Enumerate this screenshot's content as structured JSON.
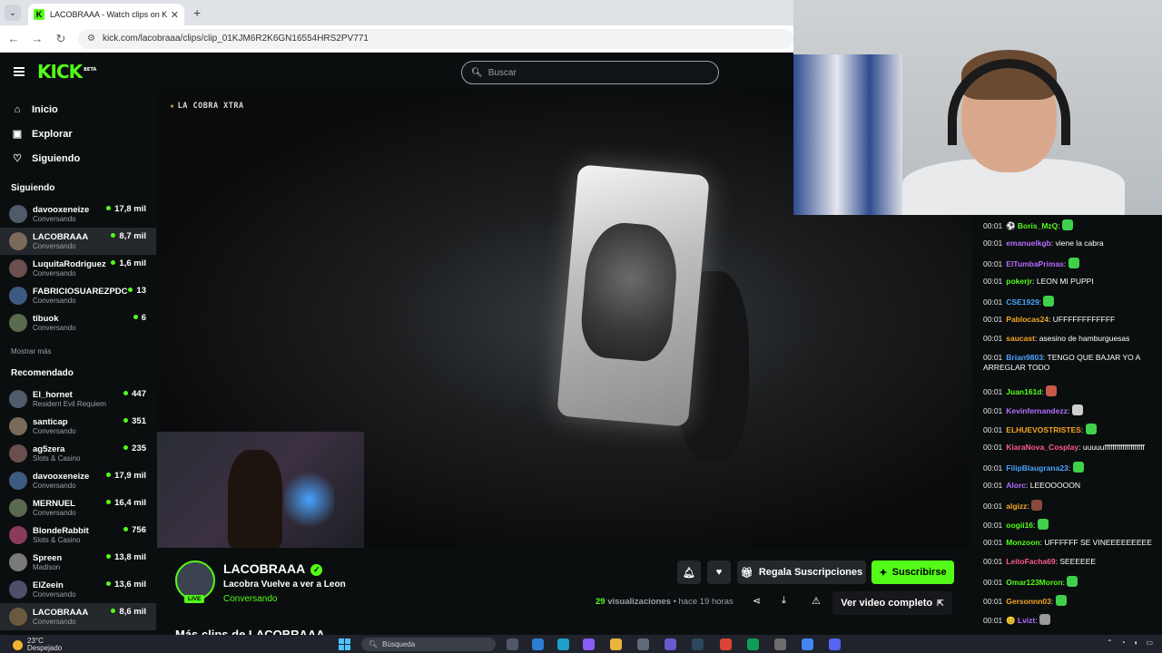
{
  "browser": {
    "tab_title": "LACOBRAAA - Watch clips on K",
    "tab_close": "✕",
    "new_tab": "+",
    "url": "kick.com/lacobraaa/clips/clip_01KJM6R2K6GN16554HRS2PV771"
  },
  "header": {
    "logo": "KICK",
    "logo_badge": "BETA",
    "search_placeholder": "Buscar"
  },
  "sidebar": {
    "nav": [
      {
        "label": "Inicio",
        "icon": "home-icon"
      },
      {
        "label": "Explorar",
        "icon": "compass-icon"
      },
      {
        "label": "Siguiendo",
        "icon": "heart-icon"
      }
    ],
    "following_title": "Siguiendo",
    "following": [
      {
        "name": "davooxeneize",
        "cat": "Conversando",
        "viewers": "17,8 mil"
      },
      {
        "name": "LACOBRAAA",
        "cat": "Conversando",
        "viewers": "8,7 mil"
      },
      {
        "name": "LuquitaRodriguez",
        "cat": "Conversando",
        "viewers": "1,6 mil"
      },
      {
        "name": "FABRICIOSUAREZPDC",
        "cat": "Conversando",
        "viewers": "13"
      },
      {
        "name": "tibuok",
        "cat": "Conversando",
        "viewers": "6"
      }
    ],
    "show_more": "Mostrar más",
    "recommended_title": "Recomendado",
    "recommended": [
      {
        "name": "El_hornet",
        "cat": "Resident Evil Requiem",
        "viewers": "447"
      },
      {
        "name": "santicap",
        "cat": "Conversando",
        "viewers": "351"
      },
      {
        "name": "ag5zera",
        "cat": "Slots & Casino",
        "viewers": "235"
      },
      {
        "name": "davooxeneize",
        "cat": "Conversando",
        "viewers": "17,9 mil"
      },
      {
        "name": "MERNUEL",
        "cat": "Conversando",
        "viewers": "16,4 mil"
      },
      {
        "name": "BlondeRabbit",
        "cat": "Slots & Casino",
        "viewers": "756"
      },
      {
        "name": "Spreen",
        "cat": "Madison",
        "viewers": "13,8 mil"
      },
      {
        "name": "ElZeein",
        "cat": "Conversando",
        "viewers": "13,6 mil"
      },
      {
        "name": "LACOBRAAA",
        "cat": "Conversando",
        "viewers": "8,6 mil"
      }
    ]
  },
  "video": {
    "watermark": "LA COBRA XTRA"
  },
  "clip": {
    "channel": "LACOBRAAA",
    "live_badge": "LIVE",
    "title": "Lacobra Vuelve a ver a Leon",
    "category": "Conversando",
    "views_count": "29",
    "views_label": "visualizaciones",
    "time": "• hace 19 horas",
    "gift_button": "Regala Suscripciones",
    "subscribe_button": "Suscribirse",
    "full_video_button": "Ver video completo",
    "more_clips": "Más clips de LACOBRAAA"
  },
  "chat": [
    {
      "time": "00:01",
      "user": "Boris_MzQ",
      "color": "#53fc18",
      "text": "",
      "emote": "#3fd14a",
      "badge": "⚽"
    },
    {
      "time": "00:01",
      "user": "emanuelkgb",
      "color": "#b56cff",
      "text": "viene la cabra"
    },
    {
      "time": "00:01",
      "user": "ElTumbaPrimas",
      "color": "#b56cff",
      "text": "",
      "emote": "#3fd14a"
    },
    {
      "time": "00:01",
      "user": "pokerjr",
      "color": "#53fc18",
      "text": "LEON MI PUPPI"
    },
    {
      "time": "00:01",
      "user": "CSE1929",
      "color": "#4aa3ff",
      "text": "",
      "emote": "#3fd14a"
    },
    {
      "time": "00:01",
      "user": "Pablocas24",
      "color": "#f5a623",
      "text": "UFFFFFFFFFFFF"
    },
    {
      "time": "00:01",
      "user": "saucast",
      "color": "#f5a623",
      "text": "asesino de hamburguesas"
    },
    {
      "time": "00:01",
      "user": "Brian9803",
      "color": "#4aa3ff",
      "text": "TENGO QUE BAJAR YO A ARREGLAR TODO"
    },
    {
      "time": "00:01",
      "user": "Juan161d",
      "color": "#53fc18",
      "text": "",
      "emote": "#c95a4a"
    },
    {
      "time": "00:01",
      "user": "Kevinfernandezz",
      "color": "#b56cff",
      "text": "",
      "emote": "#cfcfcf"
    },
    {
      "time": "00:01",
      "user": "ELHUEVOSTRISTES",
      "color": "#f5a623",
      "text": "",
      "emote": "#3fd14a"
    },
    {
      "time": "00:01",
      "user": "KiaraNova_Cosplay",
      "color": "#ff5a8a",
      "text": "uuuuuffffffffffffffffffff"
    },
    {
      "time": "00:01",
      "user": "FilipBlaugrana23",
      "color": "#4aa3ff",
      "text": "",
      "emote": "#3fd14a"
    },
    {
      "time": "00:01",
      "user": "Alorc",
      "color": "#b56cff",
      "text": "LEEOOOOON"
    },
    {
      "time": "00:01",
      "user": "algizz",
      "color": "#f5a623",
      "text": "",
      "emote": "#8a4a3a"
    },
    {
      "time": "00:01",
      "user": "oogii16",
      "color": "#53fc18",
      "text": "",
      "emote": "#3fd14a"
    },
    {
      "time": "00:01",
      "user": "Monzoon",
      "color": "#53fc18",
      "text": "UFFFFFF SE VINEEEEEEEEE"
    },
    {
      "time": "00:01",
      "user": "LeitoFacha69",
      "color": "#ff5a8a",
      "text": "SEEEEEE"
    },
    {
      "time": "00:01",
      "user": "Omar123Moron",
      "color": "#53fc18",
      "text": "",
      "emote": "#3fd14a"
    },
    {
      "time": "00:01",
      "user": "Gersonnn03",
      "color": "#f5a623",
      "text": "",
      "emote": "#3fd14a"
    },
    {
      "time": "00:01",
      "user": "Lvizt",
      "color": "#b56cff",
      "text": "",
      "emote": "#9a9a9a",
      "badge": "😊"
    }
  ],
  "taskbar": {
    "weather_temp": "23°C",
    "weather_desc": "Despejado",
    "search": "Búsqueda"
  }
}
